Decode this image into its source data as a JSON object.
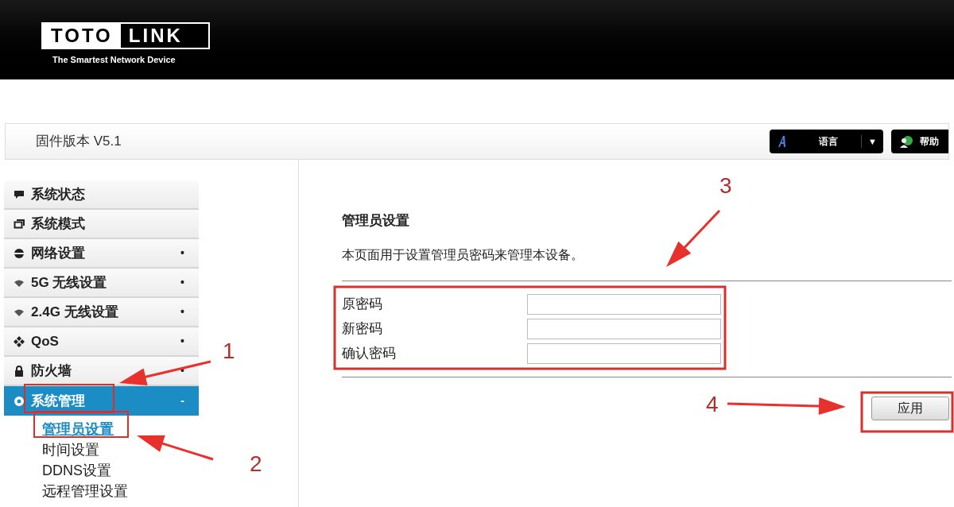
{
  "header": {
    "logo_left": "TOTO",
    "logo_right": "LINK",
    "tagline": "The Smartest Network Device"
  },
  "toolbar": {
    "firmware": "固件版本 V5.1",
    "language_button": "语言",
    "language_caret": "▼",
    "help_button": "帮助"
  },
  "sidebar": {
    "items": [
      {
        "label": "系统状态",
        "selected": false
      },
      {
        "label": "系统模式",
        "selected": false
      },
      {
        "label": "网络设置",
        "marker": "•",
        "selected": false
      },
      {
        "label": "5G 无线设置",
        "marker": "•",
        "selected": false
      },
      {
        "label": "2.4G 无线设置",
        "marker": "•",
        "selected": false
      },
      {
        "label": "QoS",
        "marker": "•",
        "selected": false
      },
      {
        "label": "防火墙",
        "marker": "•",
        "selected": false
      },
      {
        "label": "系统管理",
        "marker": "-",
        "selected": true,
        "children": [
          {
            "label": "管理员设置",
            "selected": true
          },
          {
            "label": "时间设置",
            "selected": false
          },
          {
            "label": "DDNS设置",
            "selected": false
          },
          {
            "label": "远程管理设置",
            "selected": false
          }
        ]
      }
    ]
  },
  "content": {
    "title": "管理员设置",
    "description": "本页面用于设置管理员密码来管理本设备。",
    "fields": [
      {
        "label": "原密码"
      },
      {
        "label": "新密码"
      },
      {
        "label": "确认密码"
      }
    ],
    "apply_button": "应用"
  },
  "annotations": {
    "labels": [
      "1",
      "2",
      "3",
      "4"
    ]
  }
}
